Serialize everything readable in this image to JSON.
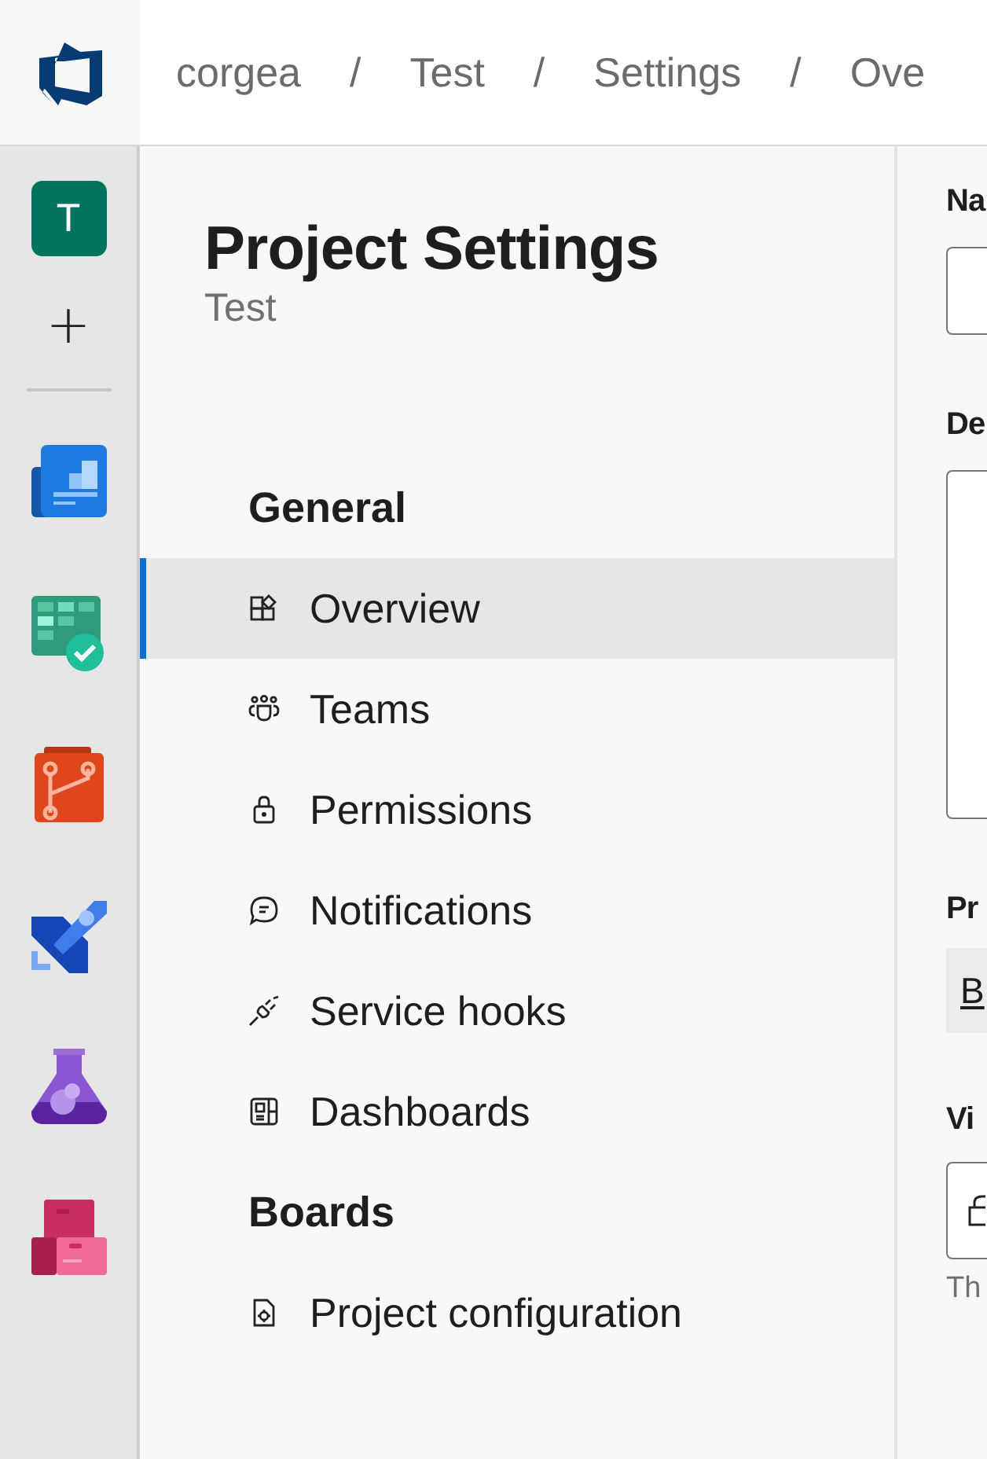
{
  "breadcrumb": [
    {
      "label": "corgea"
    },
    {
      "separator": "/",
      "label": "Test"
    },
    {
      "separator": "/",
      "label": "Settings"
    },
    {
      "separator": "/",
      "label": "Ove"
    }
  ],
  "rail": {
    "project_initial": "T",
    "add": "+",
    "apps": [
      {
        "kind": "boards"
      },
      {
        "kind": "plans"
      },
      {
        "kind": "repos"
      },
      {
        "kind": "pipelines"
      },
      {
        "kind": "tests"
      },
      {
        "kind": "artifacts"
      }
    ]
  },
  "settings": {
    "title": "Project Settings",
    "subtitle": "Test",
    "sections": [
      {
        "heading": "General",
        "items": [
          {
            "label": "Overview",
            "kind": "overview",
            "selected": true
          },
          {
            "label": "Teams",
            "kind": "teams",
            "selected": false
          },
          {
            "label": "Permissions",
            "kind": "lock",
            "selected": false
          },
          {
            "label": "Notifications",
            "kind": "chat",
            "selected": false
          },
          {
            "label": "Service hooks",
            "kind": "plug",
            "selected": false
          },
          {
            "label": "Dashboards",
            "kind": "dashboard",
            "selected": false
          }
        ]
      },
      {
        "heading": "Boards",
        "items": [
          {
            "label": "Project configuration",
            "kind": "config",
            "selected": false
          }
        ]
      }
    ]
  },
  "form": {
    "name_label": "Na",
    "description_label": "De",
    "process_label": "Pr",
    "process_link": "B",
    "visibility_label": "Vi",
    "visibility_note": "Th"
  }
}
